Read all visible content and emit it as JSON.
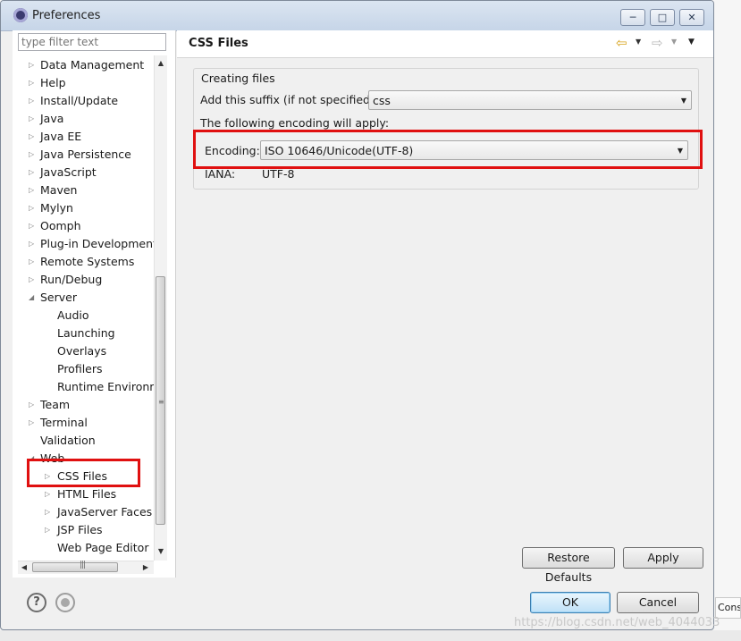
{
  "window": {
    "title": "Preferences",
    "minimize": "─",
    "maximize": "□",
    "close": "✕"
  },
  "filter": {
    "placeholder": "type filter text"
  },
  "tree": {
    "items": [
      {
        "label": "Data Management",
        "twisty": "▷"
      },
      {
        "label": "Help",
        "twisty": "▷"
      },
      {
        "label": "Install/Update",
        "twisty": "▷"
      },
      {
        "label": "Java",
        "twisty": "▷"
      },
      {
        "label": "Java EE",
        "twisty": "▷"
      },
      {
        "label": "Java Persistence",
        "twisty": "▷"
      },
      {
        "label": "JavaScript",
        "twisty": "▷"
      },
      {
        "label": "Maven",
        "twisty": "▷"
      },
      {
        "label": "Mylyn",
        "twisty": "▷"
      },
      {
        "label": "Oomph",
        "twisty": "▷"
      },
      {
        "label": "Plug-in Development",
        "twisty": "▷"
      },
      {
        "label": "Remote Systems",
        "twisty": "▷"
      },
      {
        "label": "Run/Debug",
        "twisty": "▷"
      },
      {
        "label": "Server",
        "twisty": "◢"
      },
      {
        "label": "Audio",
        "twisty": ""
      },
      {
        "label": "Launching",
        "twisty": ""
      },
      {
        "label": "Overlays",
        "twisty": ""
      },
      {
        "label": "Profilers",
        "twisty": ""
      },
      {
        "label": "Runtime Environme",
        "twisty": ""
      },
      {
        "label": "Team",
        "twisty": "▷"
      },
      {
        "label": "Terminal",
        "twisty": "▷"
      },
      {
        "label": "Validation",
        "twisty": ""
      },
      {
        "label": "Web",
        "twisty": "◢"
      },
      {
        "label": "CSS Files",
        "twisty": "▷"
      },
      {
        "label": "HTML Files",
        "twisty": "▷"
      },
      {
        "label": "JavaServer Faces T",
        "twisty": "▷"
      },
      {
        "label": "JSP Files",
        "twisty": "▷"
      },
      {
        "label": "Web Page Editor",
        "twisty": ""
      }
    ],
    "scroll": {
      "up": "▲",
      "down": "▼",
      "left": "◀",
      "right": "▶",
      "grip": "≡",
      "hgrip": "|||"
    }
  },
  "page": {
    "title": "CSS Files",
    "nav": {
      "back": "⇦",
      "forward": "⇨",
      "menu": "▼"
    },
    "group_title": "Creating files",
    "suffix_label": "Add this suffix (if not specified):",
    "suffix_value": "css",
    "encoding_note": "The following encoding will apply:",
    "encoding_label": "Encoding:",
    "encoding_value": "ISO 10646/Unicode(UTF-8)",
    "iana_label": "IANA:",
    "iana_value": "UTF-8",
    "combo_arrow": "▼"
  },
  "buttons": {
    "restore": "Restore Defaults",
    "apply": "Apply",
    "ok": "OK",
    "cancel": "Cancel"
  },
  "footer": {
    "help": "?"
  },
  "background": {
    "console_tab": "Conso",
    "watermark": "https://blog.csdn.net/web_4044033",
    "side_mark": ":"
  }
}
